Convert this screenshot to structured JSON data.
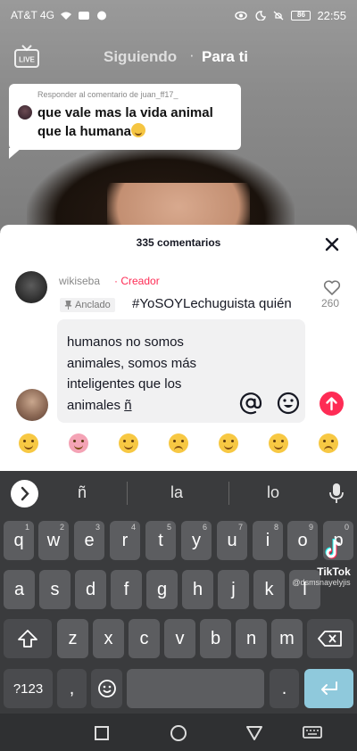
{
  "status_bar": {
    "carrier": "AT&T 4G",
    "battery": "86",
    "time": "22:55"
  },
  "top_nav": {
    "live_label": "LIVE",
    "following": "Siguiendo",
    "separator": "·",
    "for_you": "Para ti"
  },
  "reply_sticker": {
    "header": "Responder al comentario de juan_ff17_",
    "text": "que vale mas la vida animal que la humana"
  },
  "comments": {
    "count_label": "335 comentarios",
    "pinned": {
      "username": "wikiseba",
      "creator_label": "· Creador",
      "pinned_label": "Anclado",
      "text": "#YoSOYLechuguista quién",
      "likes": "260"
    }
  },
  "compose": {
    "text_main": "humanos no somos animales, somos más inteligentes que los animales ",
    "text_tail": "ñ"
  },
  "emoji_bar": [
    "grin",
    "smiling-face-with-hearts",
    "tears-of-joy",
    "flushed",
    "smirk",
    "sunglasses",
    "pleading"
  ],
  "keyboard": {
    "suggestions": [
      "ñ",
      "la",
      "lo"
    ],
    "row1": [
      {
        "k": "q",
        "h": "1"
      },
      {
        "k": "w",
        "h": "2"
      },
      {
        "k": "e",
        "h": "3"
      },
      {
        "k": "r",
        "h": "4"
      },
      {
        "k": "t",
        "h": "5"
      },
      {
        "k": "y",
        "h": "6"
      },
      {
        "k": "u",
        "h": "7"
      },
      {
        "k": "i",
        "h": "8"
      },
      {
        "k": "o",
        "h": "9"
      },
      {
        "k": "p",
        "h": "0"
      }
    ],
    "row2": [
      "a",
      "s",
      "d",
      "f",
      "g",
      "h",
      "j",
      "k",
      "l"
    ],
    "row3": [
      "z",
      "x",
      "c",
      "v",
      "b",
      "n",
      "m"
    ],
    "symbols_key": "?123",
    "comma_key": ",",
    "period_key": "."
  },
  "watermark": {
    "brand": "TikTok",
    "handle": "@dsmsnayelyjis"
  },
  "colors": {
    "accent": "#fe2c55",
    "keyboard_bg": "#3a3b3d",
    "key_bg": "#5c5d60",
    "enter_key": "#8fc9dc"
  }
}
